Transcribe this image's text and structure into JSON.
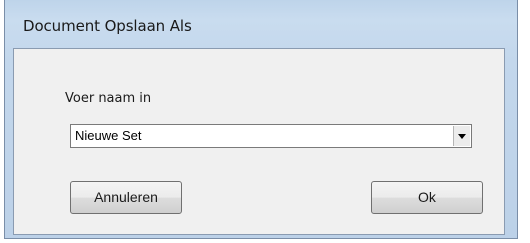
{
  "window": {
    "title": "Document Opslaan Als"
  },
  "form": {
    "name_label": "Voer naam in",
    "name_value": "Nieuwe Set"
  },
  "buttons": {
    "cancel_label": "Annuleren",
    "ok_label": "Ok"
  },
  "icons": {
    "dropdown": "chevron-down-icon"
  }
}
